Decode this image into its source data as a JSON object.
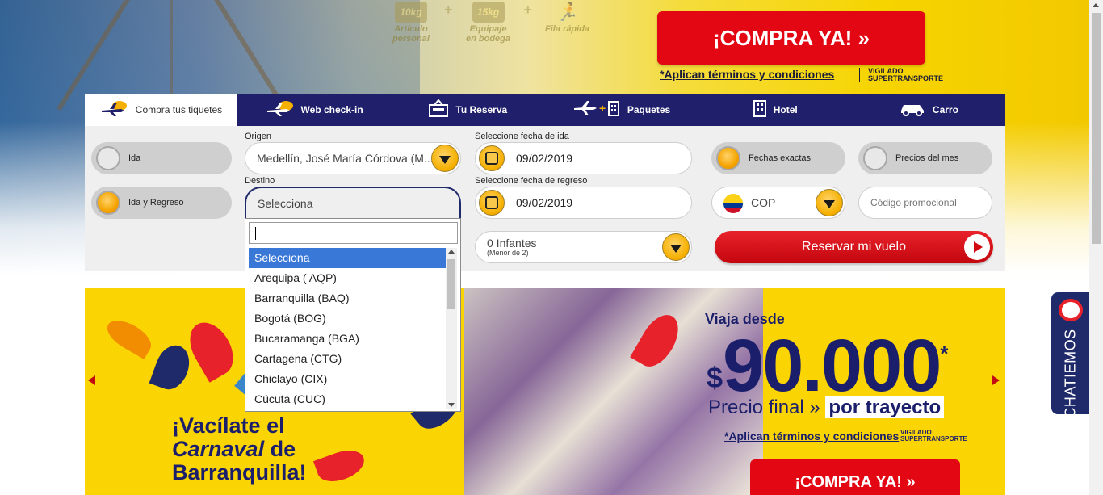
{
  "hero": {
    "baggage": [
      {
        "badge": "10kg",
        "label": "Artículo personal"
      },
      {
        "badge": "15kg",
        "label": "Equipaje en bodega"
      },
      {
        "badge": "",
        "label": "Fila rápida"
      }
    ],
    "cta_label": "¡COMPRA YA!  »",
    "terms": "*Aplican términos y condiciones",
    "vigilado": "VIGILADO SUPERTRANSPORTE"
  },
  "tabs": [
    {
      "label": "Compra tus tiquetes",
      "icon": "plane-cloud-icon"
    },
    {
      "label": "Web check-in",
      "icon": "plane-cloud-icon"
    },
    {
      "label": "Tu Reserva",
      "icon": "reservation-icon"
    },
    {
      "label": "Paquetes",
      "icon": "plane-building-icon"
    },
    {
      "label": "Hotel",
      "icon": "building-icon"
    },
    {
      "label": "Carro",
      "icon": "car-icon"
    }
  ],
  "form": {
    "trip_type": {
      "ida": "Ida",
      "ida_regreso": "Ida y Regreso"
    },
    "origen": {
      "label": "Origen",
      "value": "Medellín, José María Córdova (M..."
    },
    "destino": {
      "label": "Destino",
      "value": "Selecciona"
    },
    "fecha_ida": {
      "label": "Seleccione fecha de ida",
      "value": "09/02/2019"
    },
    "fecha_regreso": {
      "label": "Seleccione fecha de regreso",
      "value": "09/02/2019"
    },
    "infantes": {
      "value": "0 Infantes",
      "sub": "(Menor de 2)"
    },
    "fechas_exactas": "Fechas exactas",
    "precios_mes": "Precios del mes",
    "moneda": "COP",
    "codigo_placeholder": "Código promocional",
    "reservar": "Reservar mi vuelo"
  },
  "dropdown": {
    "options": [
      "Selecciona",
      "Arequipa ( AQP)",
      "Barranquilla (BAQ)",
      "Bogotá (BOG)",
      "Bucaramanga (BGA)",
      "Cartagena (CTG)",
      "Chiclayo (CIX)",
      "Cúcuta (CUC)"
    ],
    "selected_index": 0
  },
  "banner": {
    "title_line1": "¡Vacílate el",
    "title_line2a": "Carnaval",
    "title_line2b": " de",
    "title_line3": "Barranquilla!",
    "viaja": "Viaja desde",
    "currency": "$",
    "price": "90.000",
    "star": "*",
    "precio_final": "Precio final » ",
    "por_trayecto": "por trayecto",
    "terms": "*Aplican términos y condiciones",
    "vigilado": "VIGILADO SUPERTRANSPORTE",
    "cta_label": "¡COMPRA YA!  »"
  },
  "chat": {
    "label": "CHATIEMOS"
  },
  "colors": {
    "navy": "#1f1f6b",
    "red": "#e30613",
    "yellow": "#fbd404",
    "orange": "#f5b000"
  }
}
